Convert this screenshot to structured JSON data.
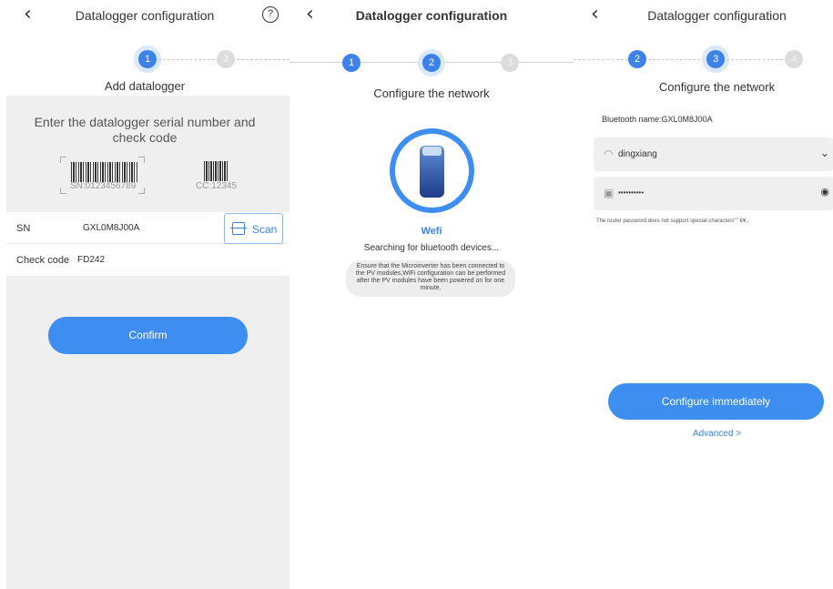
{
  "colors": {
    "accent": "#3d8ef0",
    "step_active": "#3d82e9",
    "step_inactive": "#dcdcdc",
    "panel_grey": "#efefef"
  },
  "panel1": {
    "back_icon": "back-arrow-icon",
    "title": "Datalogger configuration",
    "help_icon": "help-circle-icon",
    "help_glyph": "?",
    "steps": [
      "1",
      "2"
    ],
    "subtitle": "Add datalogger",
    "hint": "Enter the datalogger serial number and check code",
    "sn_example": "SN:0123456789",
    "cc_example": "CC:12345",
    "sn_label": "SN",
    "sn_value": "GXL0M8J00A",
    "scan_label": "Scan",
    "check_label": "Check code",
    "check_value": "FD242",
    "confirm_label": "Confirm"
  },
  "panel2": {
    "back_icon": "back-arrow-icon",
    "title": "Datalogger configuration",
    "steps": [
      "1",
      "2",
      "3"
    ],
    "subtitle": "Configure the network",
    "device_name": "Wefi",
    "status": "Searching for bluetooth devices...",
    "note": "Ensure that the Microinverter has been connected to the PV modules,WiFi configuration can be performed after the PV modules have been powered on for one minute."
  },
  "panel3": {
    "back_icon": "back-arrow-icon",
    "title": "Datalogger configuration",
    "steps": [
      "2",
      "3",
      "4"
    ],
    "subtitle": "Configure the network",
    "bluetooth_name": "Bluetooth name:GXL0M8J00A",
    "wifi_icon": "wifi-icon",
    "wifi_name": "dingxiang",
    "lock_icon": "lock-icon",
    "password_mask": "••••••••••",
    "eye_icon": "eye-icon",
    "password_note": "The router password does not support special characters'\"' €¥..",
    "configure_label": "Configure immediately",
    "advanced_label": "Advanced >"
  }
}
